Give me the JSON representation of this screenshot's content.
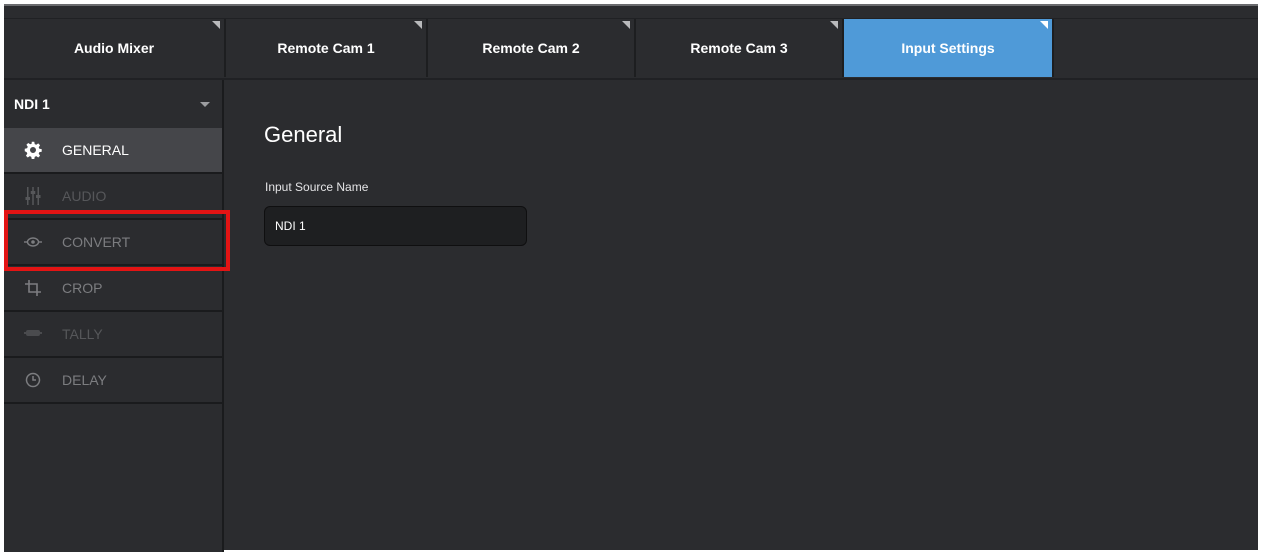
{
  "tabs": [
    {
      "label": "Audio Mixer",
      "active": false
    },
    {
      "label": "Remote Cam 1",
      "active": false
    },
    {
      "label": "Remote Cam 2",
      "active": false
    },
    {
      "label": "Remote Cam 3",
      "active": false
    },
    {
      "label": "Input Settings",
      "active": true
    }
  ],
  "sidebar": {
    "source": "NDI 1",
    "items": [
      {
        "label": "GENERAL",
        "icon": "gear-icon",
        "state": "active"
      },
      {
        "label": "AUDIO",
        "icon": "sliders-icon",
        "state": "disabled"
      },
      {
        "label": "CONVERT",
        "icon": "convert-icon",
        "state": "normal"
      },
      {
        "label": "CROP",
        "icon": "crop-icon",
        "state": "normal"
      },
      {
        "label": "TALLY",
        "icon": "tally-icon",
        "state": "disabled"
      },
      {
        "label": "DELAY",
        "icon": "clock-icon",
        "state": "normal"
      }
    ]
  },
  "main": {
    "title": "General",
    "field_label": "Input Source Name",
    "field_value": "NDI 1"
  },
  "colors": {
    "accent": "#4f9ad8",
    "highlight": "#e31414",
    "background": "#2b2c2f"
  }
}
